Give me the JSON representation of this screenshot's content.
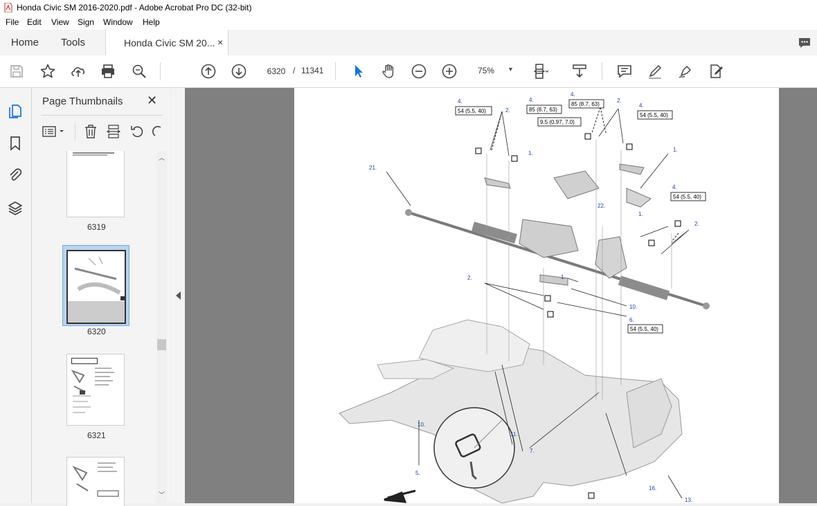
{
  "window": {
    "title": "Honda Civic SM 2016-2020.pdf - Adobe Acrobat Pro DC (32-bit)"
  },
  "menu": {
    "file": "File",
    "edit": "Edit",
    "view": "View",
    "sign": "Sign",
    "window": "Window",
    "help": "Help"
  },
  "tabs": {
    "home": "Home",
    "tools": "Tools",
    "document": "Honda Civic SM 20...",
    "close_symbol": "×"
  },
  "toolbar": {
    "current_page": "6320",
    "page_separator": "/",
    "total_pages": "11341",
    "zoom": "75%",
    "icons": [
      "save-icon",
      "bookmark-star-icon",
      "upload-icon",
      "print-icon",
      "zoom-search-icon",
      "page-up-icon",
      "page-down-icon",
      "select-pointer-icon",
      "hand-icon",
      "zoom-out-icon",
      "zoom-in-icon",
      "zoom-dropdown-icon",
      "fit-page-icon",
      "scroll-mode-icon",
      "comment-icon",
      "highlight-pen-icon",
      "sign-pen-icon",
      "edit-pdf-icon",
      "chat-icon"
    ]
  },
  "sidebar": {
    "panel_title": "Page Thumbnails",
    "close_symbol": "✕",
    "thumbnails": [
      {
        "label": "6319"
      },
      {
        "label": "6320",
        "selected": true
      },
      {
        "label": "6321"
      },
      {
        "label": ""
      }
    ]
  },
  "diagram": {
    "callouts": {
      "c1": "4.",
      "t1": "54 (5.5, 40)",
      "c2": "2.",
      "c3": "4.",
      "t3": "85 (8.7, 63)",
      "c4": "4.",
      "t4": "85 (8.7, 63)",
      "c5": "2.",
      "c6": "4.",
      "t6": "54 (5.5, 40)",
      "t7": "9.5 (0.97, 7.0)",
      "c8": "1.",
      "c9": "21.",
      "c10": "1.",
      "c11": "4.",
      "t11": "54 (5.5, 40)",
      "c12": "22.",
      "c13": "1.",
      "c14": "2.",
      "c15": "2.",
      "c16": "1.",
      "c17": "10.",
      "c18": "6.",
      "t18": "54 (5.5, 40)",
      "c19": "10.",
      "c20": "11.",
      "c21": "7.",
      "c22": "5.",
      "c23": "16.",
      "c24": "13."
    }
  }
}
